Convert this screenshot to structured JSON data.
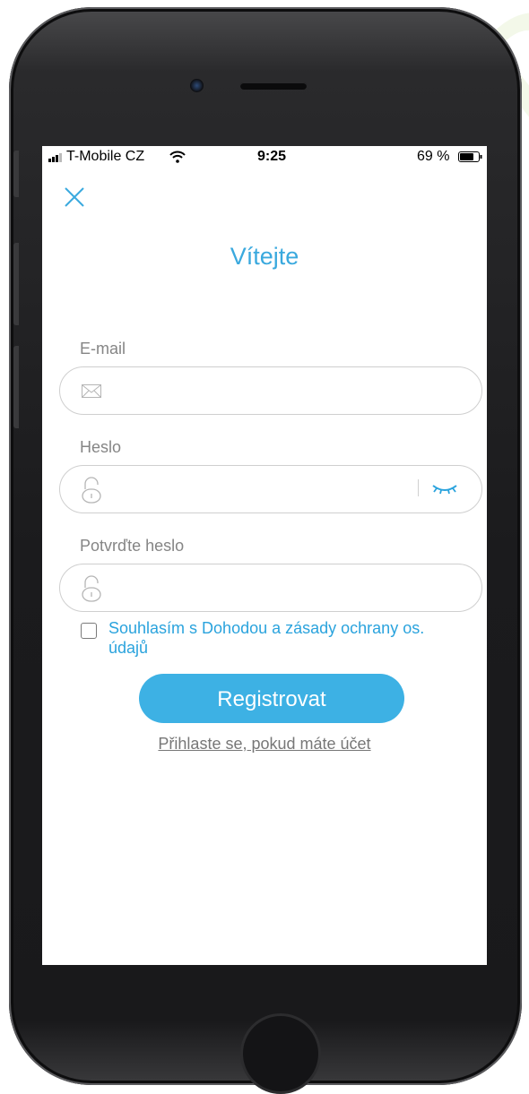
{
  "statusbar": {
    "carrier": "T-Mobile CZ",
    "time": "9:25",
    "battery": "69 %"
  },
  "form": {
    "title": "Vítejte",
    "email_label": "E-mail",
    "email_value": "",
    "password_label": "Heslo",
    "password_value": "",
    "confirm_label": "Potvrďte heslo",
    "confirm_value": "",
    "agree_text": "Souhlasím s Dohodou a zásady ochrany os. údajů",
    "agree_checked": false,
    "register_label": "Registrovat",
    "login_link": "Přihlaste se, pokud máte účet"
  },
  "icons": {
    "close": "close-icon",
    "email": "envelope-icon",
    "password": "lock-icon",
    "show_password": "eye-closed-icon",
    "wifi": "wifi-icon",
    "signal": "signal-icon",
    "battery": "battery-icon"
  },
  "colors": {
    "accent": "#3aa9de",
    "button": "#3db1e4",
    "field_border": "#cfcfcf",
    "label": "#858585"
  },
  "watermark": "WORLD"
}
